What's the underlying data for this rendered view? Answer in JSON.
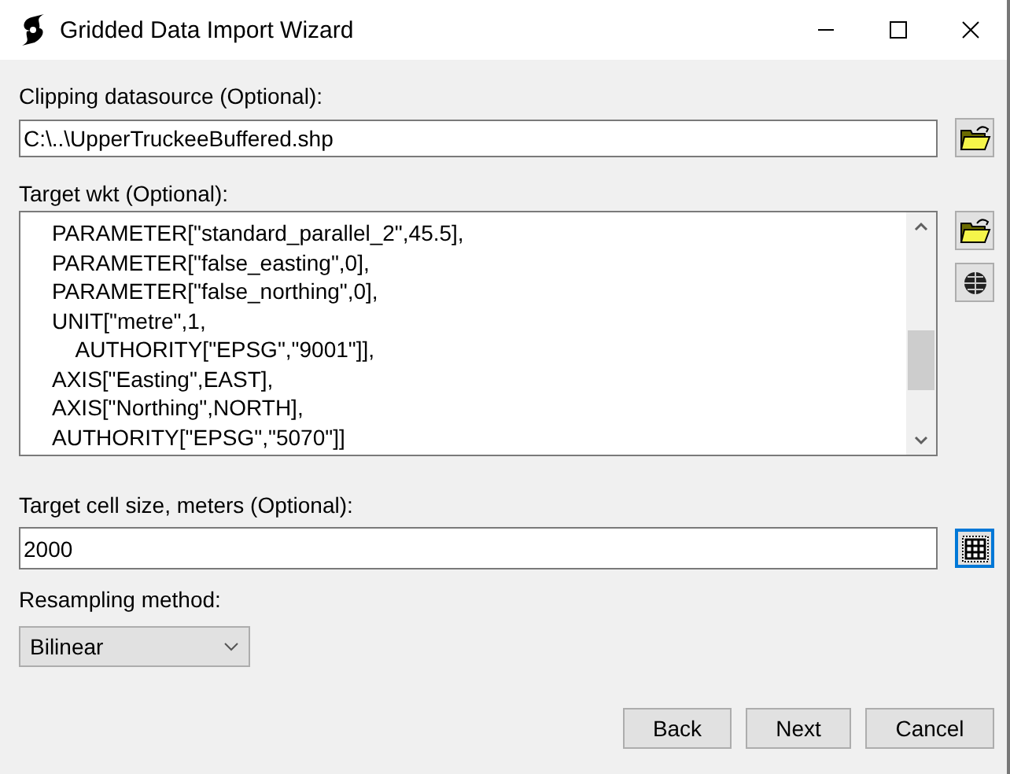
{
  "window": {
    "title": "Gridded Data Import Wizard"
  },
  "clipping": {
    "label": "Clipping datasource (Optional):",
    "value": "C:\\..\\UpperTruckeeBuffered.shp"
  },
  "wkt": {
    "label": "Target wkt (Optional):",
    "lines": [
      "PARAMETER[\"standard_parallel_2\",45.5],",
      "PARAMETER[\"false_easting\",0],",
      "PARAMETER[\"false_northing\",0],",
      "UNIT[\"metre\",1,",
      "    AUTHORITY[\"EPSG\",\"9001\"]],",
      "AXIS[\"Easting\",EAST],",
      "AXIS[\"Northing\",NORTH],",
      "AUTHORITY[\"EPSG\",\"5070\"]]"
    ]
  },
  "cell_size": {
    "label": "Target cell size, meters (Optional):",
    "value": "2000"
  },
  "resampling": {
    "label": "Resampling method:",
    "value": "Bilinear"
  },
  "buttons": [
    "Back",
    "Next",
    "Cancel"
  ]
}
